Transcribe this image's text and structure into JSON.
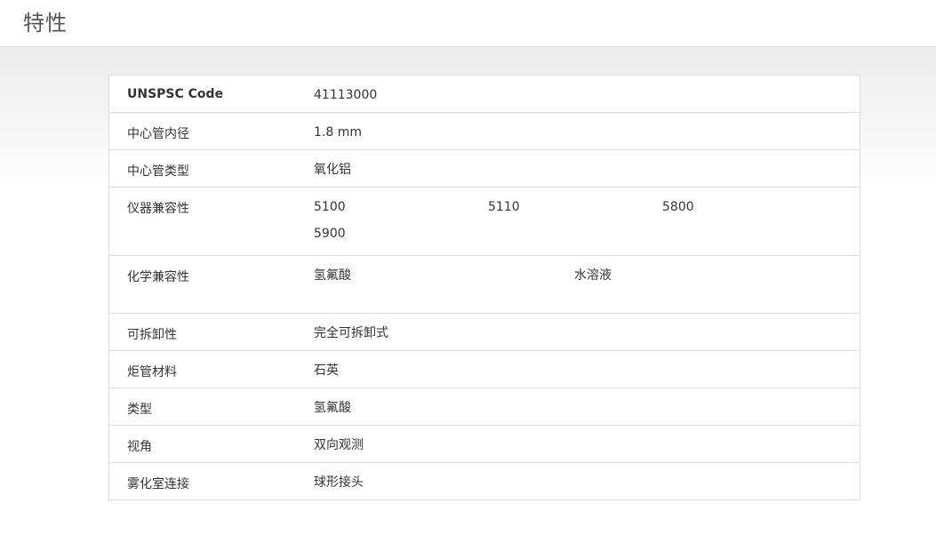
{
  "header": {
    "title": "特性"
  },
  "properties": [
    {
      "label": "UNSPSC Code",
      "values": [
        "41113000"
      ]
    },
    {
      "label": "中心管内径",
      "values": [
        "1.8 mm"
      ]
    },
    {
      "label": "中心管类型",
      "values": [
        "氧化铝"
      ]
    },
    {
      "label": "仪器兼容性",
      "values": [
        "5100",
        "5110",
        "5800",
        "5900"
      ]
    },
    {
      "label": "化学兼容性",
      "values": [
        "氢氟酸",
        "水溶液"
      ]
    },
    {
      "label": "可拆卸性",
      "values": [
        "完全可拆卸式"
      ]
    },
    {
      "label": "炬管材料",
      "values": [
        "石英"
      ]
    },
    {
      "label": "类型",
      "values": [
        "氢氟酸"
      ]
    },
    {
      "label": "视角",
      "values": [
        "双向观测"
      ]
    },
    {
      "label": "雾化室连接",
      "values": [
        "球形接头"
      ]
    }
  ]
}
